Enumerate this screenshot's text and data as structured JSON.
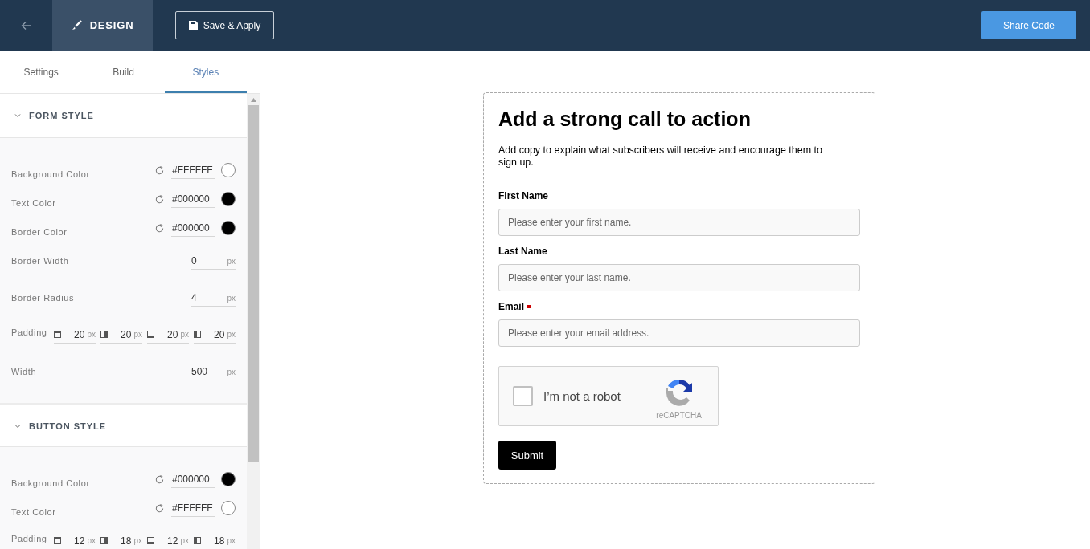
{
  "toolbar": {
    "mode": "DESIGN",
    "save_button": "Save & Apply",
    "share_button": "Share Code"
  },
  "sidebar": {
    "tabs": [
      {
        "label": "Settings",
        "selected": false
      },
      {
        "label": "Build",
        "selected": false
      },
      {
        "label": "Styles",
        "selected": true
      }
    ],
    "sections": [
      {
        "title": "FORM STYLE",
        "expanded": true,
        "rows": [
          {
            "kind": "color",
            "label": "Background Color",
            "value": "#FFFFFF",
            "color": "#ffffff"
          },
          {
            "kind": "color",
            "label": "Text Color",
            "value": "#000000",
            "color": "#000000"
          },
          {
            "kind": "color",
            "label": "Border Color",
            "value": "#000000",
            "color": "#000000"
          },
          {
            "kind": "number",
            "label": "Border Width",
            "value": "0",
            "unit": "px"
          },
          {
            "kind": "number",
            "label": "Border Radius",
            "value": "4",
            "unit": "px"
          },
          {
            "kind": "padding",
            "label": "Padding",
            "values": [
              {
                "value": "20",
                "unit": "px"
              },
              {
                "value": "20",
                "unit": "px"
              },
              {
                "value": "20",
                "unit": "px"
              },
              {
                "value": "20",
                "unit": "px"
              }
            ]
          },
          {
            "kind": "number",
            "label": "Width",
            "value": "500",
            "unit": "px"
          }
        ]
      },
      {
        "title": "BUTTON STYLE",
        "expanded": true,
        "rows": [
          {
            "kind": "color",
            "label": "Background Color",
            "value": "#000000",
            "color": "#000000"
          },
          {
            "kind": "color",
            "label": "Text Color",
            "value": "#FFFFFF",
            "color": "#ffffff"
          },
          {
            "kind": "padding",
            "label": "Padding",
            "values": [
              {
                "value": "12",
                "unit": "px"
              },
              {
                "value": "18",
                "unit": "px"
              },
              {
                "value": "12",
                "unit": "px"
              },
              {
                "value": "18",
                "unit": "px"
              }
            ]
          }
        ]
      }
    ]
  },
  "form": {
    "title": "Add a strong call to action",
    "description": "Add copy to explain what subscribers will receive and encourage them to sign up.",
    "fields": [
      {
        "label": "First Name",
        "placeholder": "Please enter your first name.",
        "required": false
      },
      {
        "label": "Last Name",
        "placeholder": "Please enter your last name.",
        "required": false
      },
      {
        "label": "Email",
        "placeholder": "Please enter your email address.",
        "required": true
      }
    ],
    "captcha": {
      "label": "I’m not a robot",
      "brand": "reCAPTCHA",
      "checked": false
    },
    "submit": "Submit"
  }
}
